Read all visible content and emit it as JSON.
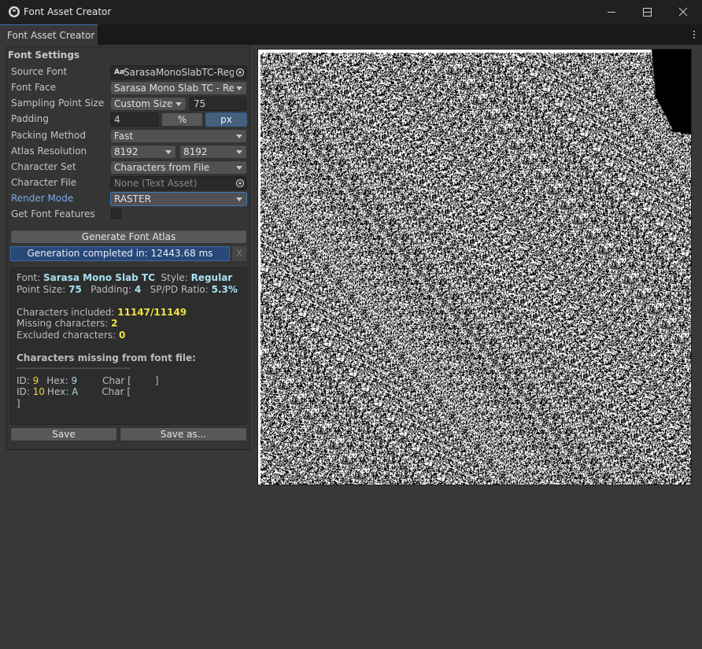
{
  "window": {
    "title": "Font Asset Creator"
  },
  "tab": {
    "label": "Font Asset Creator"
  },
  "settings": {
    "section_title": "Font Settings",
    "source_font_label": "Source Font",
    "source_font_value": "SarasaMonoSlabTC-Reg",
    "source_font_icon_text": "Aa",
    "font_face_label": "Font Face",
    "font_face_value": "Sarasa Mono Slab TC - Reg",
    "sampling_label": "Sampling Point Size",
    "sampling_mode": "Custom Size",
    "sampling_value": "75",
    "padding_label": "Padding",
    "padding_value": "4",
    "padding_percent": "%",
    "padding_px": "px",
    "packing_label": "Packing Method",
    "packing_value": "Fast",
    "atlas_label": "Atlas Resolution",
    "atlas_width": "8192",
    "atlas_height": "8192",
    "charset_label": "Character Set",
    "charset_value": "Characters from File",
    "charfile_label": "Character File",
    "charfile_value": "None (Text Asset)",
    "render_label": "Render Mode",
    "render_value": "RASTER",
    "features_label": "Get Font Features",
    "generate_label": "Generate Font Atlas",
    "progress_label": "Generation completed in: 12443.68 ms",
    "progress_value": 1.0,
    "close_label": "X",
    "save_label": "Save",
    "save_as_label": "Save as..."
  },
  "info": {
    "font_label": "Font: ",
    "font_name": "Sarasa Mono Slab TC",
    "style_label": "  Style: ",
    "style_value": "Regular",
    "point_label": "Point Size: ",
    "point_value": "75",
    "padding_label": "   Padding: ",
    "padding_value": "4",
    "ratio_label": "   SP/PD Ratio: ",
    "ratio_value": "5.3%",
    "included_label": "Characters included: ",
    "included_value": "11147/11149",
    "missing_label": "Missing characters: ",
    "missing_value": "2",
    "excluded_label": "Excluded characters: ",
    "excluded_value": "0",
    "missing_header": "Characters missing from font file:",
    "divider": "----------------------------------------",
    "id_label": "ID: ",
    "hex_label": "Hex: ",
    "char_label": "Char [",
    "row1_id": "9",
    "row1_hex": "9",
    "row1_close": "]",
    "row2_id": "10",
    "row2_hex": "A",
    "closing_bracket": "]"
  },
  "colors": {
    "accent_blue": "#3a72b0",
    "highlight_cyan": "#a8e0f0",
    "highlight_yellow": "#f0e040",
    "atlas_bg": "#ffffff",
    "atlas_ink": "#000000"
  },
  "icons": [
    "unity-logo-icon",
    "minimize-icon",
    "maximize-icon",
    "close-icon",
    "kebab-menu-icon",
    "object-picker-icon",
    "dropdown-caret-icon"
  ]
}
